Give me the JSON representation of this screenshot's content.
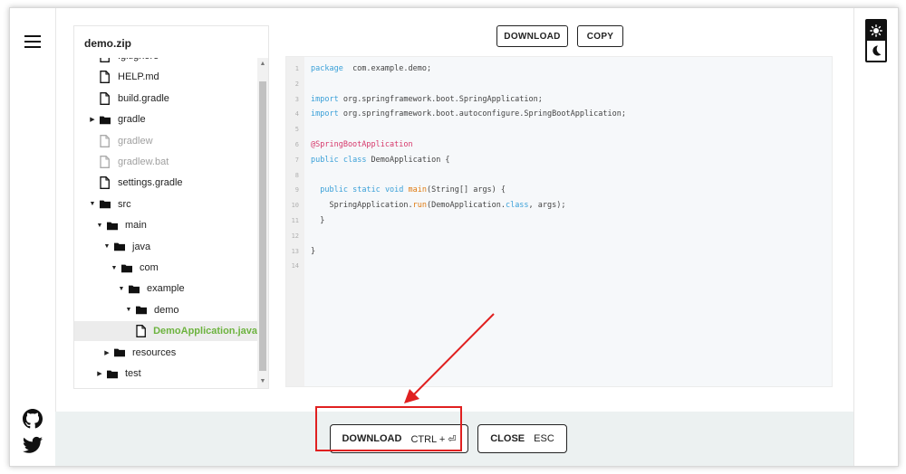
{
  "explorer": {
    "title": "demo.zip",
    "items": [
      {
        "label": ".gitignore",
        "kind": "file",
        "depth": 0,
        "expanded": null,
        "disabled": false
      },
      {
        "label": "HELP.md",
        "kind": "file",
        "depth": 0,
        "expanded": null,
        "disabled": false
      },
      {
        "label": "build.gradle",
        "kind": "file",
        "depth": 0,
        "expanded": null,
        "disabled": false
      },
      {
        "label": "gradle",
        "kind": "folder",
        "depth": 0,
        "expanded": false,
        "disabled": false
      },
      {
        "label": "gradlew",
        "kind": "file",
        "depth": 0,
        "expanded": null,
        "disabled": true
      },
      {
        "label": "gradlew.bat",
        "kind": "file",
        "depth": 0,
        "expanded": null,
        "disabled": true
      },
      {
        "label": "settings.gradle",
        "kind": "file",
        "depth": 0,
        "expanded": null,
        "disabled": false
      },
      {
        "label": "src",
        "kind": "folder",
        "depth": 0,
        "expanded": true,
        "disabled": false
      },
      {
        "label": "main",
        "kind": "folder",
        "depth": 1,
        "expanded": true,
        "disabled": false
      },
      {
        "label": "java",
        "kind": "folder",
        "depth": 2,
        "expanded": true,
        "disabled": false
      },
      {
        "label": "com",
        "kind": "folder",
        "depth": 3,
        "expanded": true,
        "disabled": false
      },
      {
        "label": "example",
        "kind": "folder",
        "depth": 4,
        "expanded": true,
        "disabled": false
      },
      {
        "label": "demo",
        "kind": "folder",
        "depth": 5,
        "expanded": true,
        "disabled": false
      },
      {
        "label": "DemoApplication.java",
        "kind": "file",
        "depth": 6,
        "expanded": null,
        "disabled": false,
        "selected": true
      },
      {
        "label": "resources",
        "kind": "folder",
        "depth": 2,
        "expanded": false,
        "disabled": false
      },
      {
        "label": "test",
        "kind": "folder",
        "depth": 1,
        "expanded": false,
        "disabled": false
      }
    ]
  },
  "toolbar": {
    "download_label": "DOWNLOAD",
    "copy_label": "COPY"
  },
  "code": {
    "lines": [
      [
        [
          "kw",
          "package"
        ],
        [
          "",
          "  com.example.demo;"
        ]
      ],
      [],
      [
        [
          "kw",
          "import"
        ],
        [
          "",
          " org.springframework.boot.SpringApplication;"
        ]
      ],
      [
        [
          "kw",
          "import"
        ],
        [
          "",
          " org.springframework.boot.autoconfigure.SpringBootApplication;"
        ]
      ],
      [],
      [
        [
          "ann",
          "@SpringBootApplication"
        ]
      ],
      [
        [
          "kw",
          "public"
        ],
        [
          "",
          " "
        ],
        [
          "kw",
          "class"
        ],
        [
          "",
          " DemoApplication {"
        ]
      ],
      [],
      [
        [
          "",
          "  "
        ],
        [
          "kw",
          "public"
        ],
        [
          "",
          " "
        ],
        [
          "kw",
          "static"
        ],
        [
          "",
          " "
        ],
        [
          "kw",
          "void"
        ],
        [
          "",
          " "
        ],
        [
          "fn",
          "main"
        ],
        [
          "",
          "(String[] args) {"
        ]
      ],
      [
        [
          "",
          "    SpringApplication."
        ],
        [
          "fn",
          "run"
        ],
        [
          "",
          "(DemoApplication."
        ],
        [
          "kw",
          "class"
        ],
        [
          "",
          ", args);"
        ]
      ],
      [
        [
          "",
          "  }"
        ]
      ],
      [],
      [
        [
          "",
          "}"
        ]
      ],
      []
    ]
  },
  "footer": {
    "download_label": "DOWNLOAD",
    "download_shortcut": "CTRL + ⏎",
    "close_label": "CLOSE",
    "close_shortcut": "ESC"
  },
  "icons": {
    "menu": "hamburger-icon",
    "github": "github-icon",
    "twitter": "twitter-icon",
    "theme_light": "sun-icon",
    "theme_dark": "moon-icon",
    "file": "file-icon",
    "folder": "folder-icon"
  },
  "colors": {
    "selected_file": "#6db33f",
    "keyword": "#3aa0d8",
    "annotation": "#d6376a",
    "method": "#e07b12",
    "highlight_box": "#e02020",
    "footer_bg": "#ecf1f1"
  }
}
